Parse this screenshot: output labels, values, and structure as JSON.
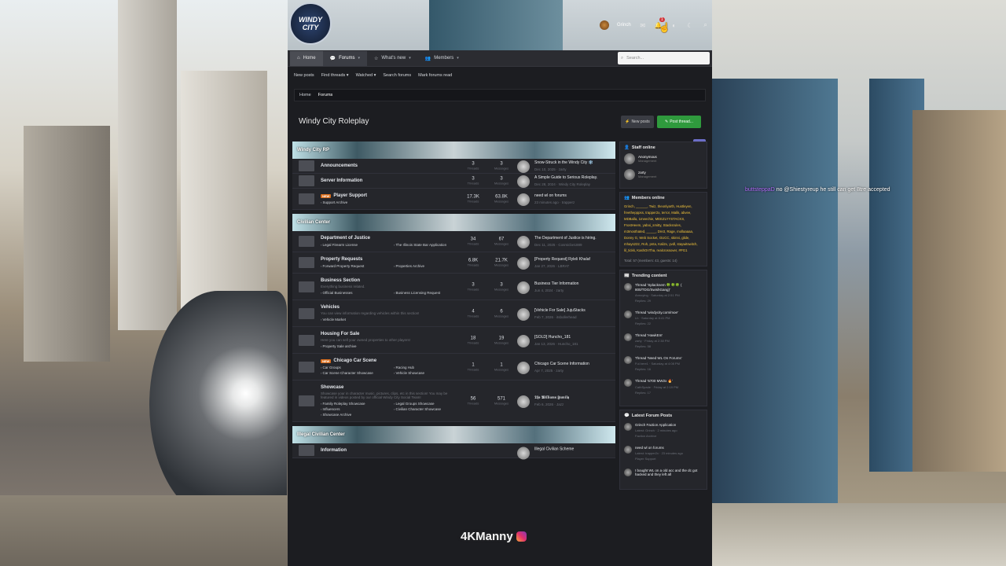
{
  "logo": {
    "text": "WINDY CITY"
  },
  "userbar": {
    "username": "Grinch",
    "alert_count": "1"
  },
  "nav": {
    "tabs": [
      {
        "label": "Home"
      },
      {
        "label": "Forums"
      },
      {
        "label": "What's new"
      },
      {
        "label": "Members"
      }
    ],
    "search_placeholder": "Search..."
  },
  "subnav": [
    "New posts",
    "Find threads",
    "Watched",
    "Search forums",
    "Mark forums read"
  ],
  "breadcrumb": [
    "Home",
    "Forums"
  ],
  "page_title": "Windy City Roleplay",
  "buttons": {
    "new_posts": "New posts",
    "post_thread": "Post thread..."
  },
  "categories": [
    {
      "title": "Windy City RP",
      "nodes": [
        {
          "name": "Announcements",
          "threads": "3",
          "messages": "3",
          "last_title": "Snow-Struck in the Windy City ❄️",
          "last_meta": "Dec 10, 2025 · zarty"
        },
        {
          "name": "Server Information",
          "threads": "3",
          "messages": "3",
          "last_title": "A Simple Guide to Serious Roleplay.",
          "last_meta": "Dec 28, 2024 · Windy City Roleplay"
        },
        {
          "name": "Player Support",
          "new": "NEW",
          "subs": [
            "Support Archive"
          ],
          "threads": "17.3K",
          "messages": "63.8K",
          "last_title": "need wl on forums",
          "last_meta": "23 minutes ago · trapperz"
        }
      ]
    },
    {
      "title": "Civilian Center",
      "nodes": [
        {
          "name": "Department of Justice",
          "subs": [
            "Legal Firearm License",
            "The Illinois State Bar Application"
          ],
          "threads": "34",
          "messages": "67",
          "last_title": "The Department of Justice is hiring.",
          "last_meta": "Dec 11, 2025 · Cosmicbe1889"
        },
        {
          "name": "Property Requests",
          "subs": [
            "Forward Property Request",
            "Properties Archive"
          ],
          "threads": "6.8K",
          "messages": "21.7K",
          "last_title": "[Property Request] Ryleli Khalaf",
          "last_meta": "Jan 27, 2026 · LBRAT"
        },
        {
          "name": "Business Section",
          "desc": "Everything business related.",
          "subs": [
            "Official Businesses",
            "Business Licensing Request"
          ],
          "threads": "3",
          "messages": "3",
          "last_title": "Business Tier Information",
          "last_meta": "Jun 4, 2024 · zarty"
        },
        {
          "name": "Vehicles",
          "desc": "You can view information regarding vehicles within this section!",
          "subs": [
            "Vehicle Market"
          ],
          "threads": "4",
          "messages": "6",
          "last_title": "[Vehicle For Sale] JujuStacks",
          "last_meta": "Feb 7, 2026 · itsbollerhead"
        },
        {
          "name": "Housing For Sale",
          "desc": "Here you can sell your owned properties to other players!",
          "subs": [
            "Property Sale archive"
          ],
          "threads": "18",
          "messages": "19",
          "last_title": "[SOLD] Huncho_181",
          "last_meta": "Jan 13, 2026 · Huncho_181"
        },
        {
          "name": "Chicago Car Scene",
          "new": "NEW",
          "subs": [
            "Car Groups",
            "Racing Hub",
            "Car Scene Character Showcase",
            "Vehicle Showcase"
          ],
          "threads": "1",
          "messages": "1",
          "last_title": "Chicago Car Scene Information",
          "last_meta": "Apr 7, 2025 · zarty"
        },
        {
          "name": "Showcase",
          "desc": "Showcase your in character music, pictures, clips, etc in this section! You may be featured in videos posted by our official Windy City Social Team!",
          "subs": [
            "Family Roleplay Showcase",
            "Legal Groups Showcase",
            "Influencers",
            "Civilian Character Showcase",
            "Showcase Archive"
          ],
          "threads": "56",
          "messages": "571",
          "last_title": "𝕿𝖍𝖊 𝖂𝖎𝖑𝖑𝖎𝖆𝖒𝖘 𝕱𝖆𝖒𝖎𝖑𝖞",
          "last_meta": "Feb 6, 2026 · Jazz"
        }
      ]
    },
    {
      "title": "Illegal Civilian Center",
      "nodes": [
        {
          "name": "Information",
          "threads": "",
          "messages": "",
          "last_title": "Illegal Civilian Scheme",
          "last_meta": ""
        }
      ]
    }
  ],
  "labels": {
    "threads": "Threads",
    "messages": "Messages"
  },
  "sidebar": {
    "staff_title": "Staff online",
    "staff": [
      {
        "name": "Anonymous",
        "role": "Management"
      },
      {
        "name": "zarty",
        "role": "Management"
      }
    ],
    "members_title": "Members online",
    "members": "Grinch, ______, Twiz, theonlyarth, Hustleyen, freethepppss, trapper2x, terror, Malik, abvee, MDBalla, 1meechie, MEEZLYYSTACKS, FrostHeem, yaboi_smitty, Stacksrules, m3mosthated, _____, Dre3, Rage, mollaaaaa, Donny G, Web Socket, GUCC, skinni, glide, mhays222, Roh, pnta, Kali2x, yvdl, staywitswitch, lil_tickk, KashOnTha, realcrossover, #PG1",
    "totals": "Total: 57 (members: 43, guests: 14)",
    "trending_title": "Trending content",
    "trending": [
      {
        "title": "Thread 'Splacknem 🍀🍀🍀 ( 800/TDG/SwishGang)'",
        "meta": "Annoying · Saturday at 2:51 PM",
        "replies": "Replies: 29"
      },
      {
        "title": "Thread 'windycity.com/moe'",
        "meta": "Lh · Saturday at 8:41 PM",
        "replies": "Replies: 22"
      },
      {
        "title": "Thread 'HawkEm'",
        "meta": "zarty · Friday at 2:38 PM",
        "replies": "Replies: 58"
      },
      {
        "title": "Thread 'Need WL On Forums'",
        "meta": "Ful.here1 · Saturday at 4:08 PM",
        "replies": "Replies: 16"
      },
      {
        "title": "Thread '6700 MW2x 🔥'",
        "meta": "CathSpade · Friday at 2:19 PM",
        "replies": "Replies: 17"
      }
    ],
    "latest_title": "Latest Forum Posts",
    "latest": [
      {
        "title": "Grinch Faction Application",
        "meta": "Latest: Grinch · 2 minutes ago",
        "forum": "Faction Archive"
      },
      {
        "title": "need wl on forums",
        "meta": "Latest: trapper2x · 23 minutes ago",
        "forum": "Player Support"
      },
      {
        "title": "I bought WL on a old acc and the dc got hacked and they left all",
        "meta": "",
        "forum": ""
      }
    ]
  },
  "overlay": {
    "user": "buttsteppaD",
    "message": "no @Shiestyreup he still can get 8tre accepted"
  },
  "watermark": {
    "text": "4KManny"
  }
}
